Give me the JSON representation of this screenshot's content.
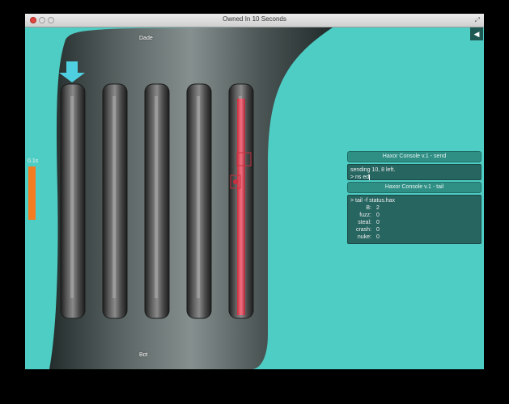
{
  "window": {
    "title": "Owned In 10 Seconds"
  },
  "game": {
    "top_player": "Dade",
    "bottom_player": "Bot",
    "timer": {
      "text": "0.1s",
      "fraction": 1.0
    },
    "lane_count": 5,
    "highlighted_lane": 5,
    "pointer_lane": 1,
    "colors": {
      "background": "#4ecdc4",
      "pipe": "#3a3a3a",
      "highlight": "#e04050",
      "timer": "#f47c20",
      "pointer": "#4fd0e0"
    }
  },
  "icons": {
    "sound": "speaker-icon",
    "pointer": "down-arrow-icon",
    "close": "close-icon",
    "minimize": "minimize-icon",
    "maximize": "maximize-icon",
    "resize": "resize-icon"
  },
  "send_console": {
    "title": "Haxor Console v.1 - send",
    "lines": [
      "sending 10, 8 left.",
      "> ns ed"
    ]
  },
  "tail_console": {
    "title": "Haxor Console v.1 - tail",
    "command": "> tail -f status.hax",
    "stats": [
      {
        "label": "B:",
        "value": "2"
      },
      {
        "label": "fuzz:",
        "value": "0"
      },
      {
        "label": "steal:",
        "value": "0"
      },
      {
        "label": "crash:",
        "value": "0"
      },
      {
        "label": "nuke:",
        "value": "0"
      }
    ]
  }
}
